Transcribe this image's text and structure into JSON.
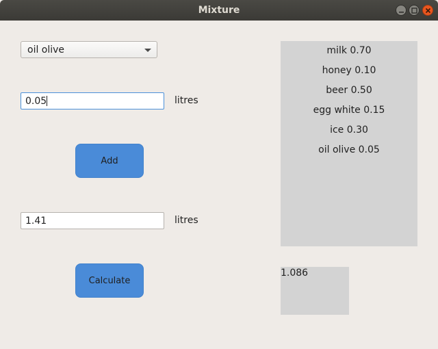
{
  "window": {
    "title": "Mixture"
  },
  "ingredient_select": {
    "selected": "oil olive"
  },
  "amount_input": {
    "value": "0.05",
    "unit": "litres"
  },
  "add_button": {
    "label": "Add"
  },
  "total_input": {
    "value": "1.41",
    "unit": "litres"
  },
  "calculate_button": {
    "label": "Calculate"
  },
  "mixture_list": {
    "items": [
      {
        "label": "milk 0.70"
      },
      {
        "label": "honey 0.10"
      },
      {
        "label": "beer 0.50"
      },
      {
        "label": "egg white 0.15"
      },
      {
        "label": "ice 0.30"
      },
      {
        "label": "oil olive 0.05"
      }
    ]
  },
  "result": {
    "value": "1.086"
  },
  "colors": {
    "button": "#4a8bd8",
    "panel": "#d3d3d3",
    "background": "#efebe7",
    "close": "#e9561f"
  },
  "icons": [
    "minimize-icon",
    "maximize-icon",
    "close-icon",
    "dropdown-arrow-icon"
  ]
}
